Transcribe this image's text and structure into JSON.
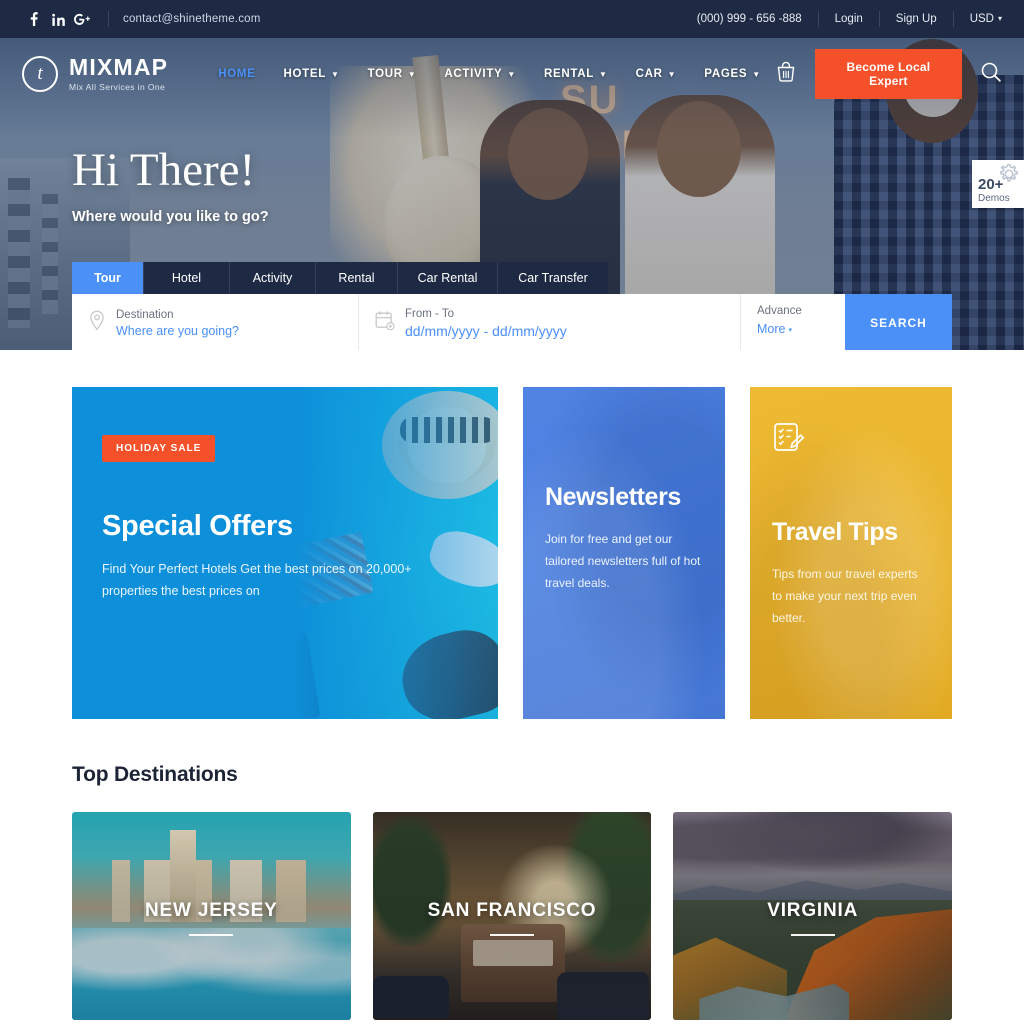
{
  "topbar": {
    "social": [
      {
        "name": "facebook-icon",
        "glyph": "f"
      },
      {
        "name": "linkedin-icon",
        "glyph": "in"
      },
      {
        "name": "googleplus-icon",
        "glyph": "G+"
      }
    ],
    "email": "contact@shinetheme.com",
    "phone": "(000) 999 - 656 -888",
    "login": "Login",
    "signup": "Sign Up",
    "currency": "USD"
  },
  "header": {
    "logo_mark": "t",
    "logo_name": "MIXMAP",
    "logo_tagline": "Mix All Services in One",
    "nav": [
      {
        "label": "HOME",
        "active": true,
        "caret": false
      },
      {
        "label": "HOTEL",
        "active": false,
        "caret": true
      },
      {
        "label": "TOUR",
        "active": false,
        "caret": true
      },
      {
        "label": "ACTIVITY",
        "active": false,
        "caret": true
      },
      {
        "label": "RENTAL",
        "active": false,
        "caret": true
      },
      {
        "label": "CAR",
        "active": false,
        "caret": true
      },
      {
        "label": "PAGES",
        "active": false,
        "caret": true
      }
    ],
    "cta_label": "Become Local Expert",
    "cta_color": "#f4502a"
  },
  "hero": {
    "title": "Hi There!",
    "subtitle": "Where would you like to go?"
  },
  "search": {
    "tabs": [
      {
        "label": "Tour",
        "active": true
      },
      {
        "label": "Hotel",
        "active": false
      },
      {
        "label": "Activity",
        "active": false
      },
      {
        "label": "Rental",
        "active": false
      },
      {
        "label": "Car Rental",
        "active": false
      },
      {
        "label": "Car Transfer",
        "active": false
      }
    ],
    "destination_label": "Destination",
    "destination_placeholder": "Where are you going?",
    "date_label": "From - To",
    "date_placeholder": "dd/mm/yyyy - dd/mm/yyyy",
    "advance_label": "Advance",
    "advance_more": "More",
    "button": "SEARCH",
    "accent": "#4a90f7"
  },
  "demos_badge": {
    "count": "20+",
    "label": "Demos"
  },
  "promos": {
    "offers": {
      "badge": "HOLIDAY SALE",
      "title": "Special Offers",
      "text": "Find Your Perfect Hotels Get the best prices on 20,000+ properties the best prices on",
      "color": "#0d8fd9"
    },
    "newsletters": {
      "title": "Newsletters",
      "text": "Join for free and get our tailored newsletters full of hot travel deals.",
      "color": "#4a7fe0"
    },
    "tips": {
      "title": "Travel Tips",
      "text": "Tips from our travel experts to make your next trip even better.",
      "color": "#eab52e"
    }
  },
  "destinations": {
    "heading": "Top Destinations",
    "items": [
      {
        "name": "NEW JERSEY"
      },
      {
        "name": "SAN FRANCISCO"
      },
      {
        "name": "VIRGINIA"
      }
    ]
  }
}
